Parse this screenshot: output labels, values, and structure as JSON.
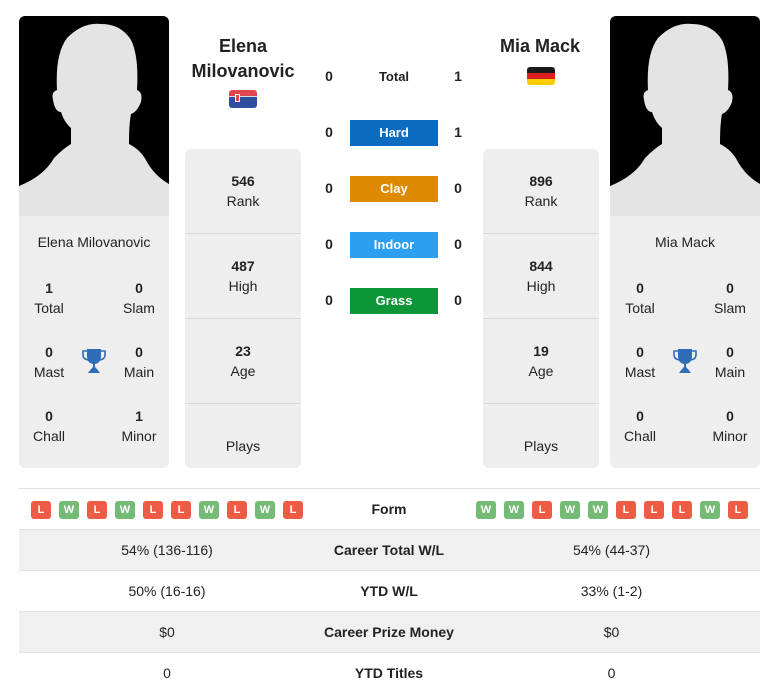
{
  "player1": {
    "name": "Elena Milovanovic",
    "name_line1": "Elena",
    "name_line2": "Milovanovic",
    "country": "Serbia",
    "flag_icon": "serbia-flag-icon",
    "titles": {
      "total": {
        "value": "1",
        "label": "Total"
      },
      "slam": {
        "value": "0",
        "label": "Slam"
      },
      "mast": {
        "value": "0",
        "label": "Mast"
      },
      "main": {
        "value": "0",
        "label": "Main"
      },
      "chall": {
        "value": "0",
        "label": "Chall"
      },
      "minor": {
        "value": "1",
        "label": "Minor"
      }
    },
    "stats": {
      "rank": {
        "value": "546",
        "label": "Rank"
      },
      "high": {
        "value": "487",
        "label": "High"
      },
      "age": {
        "value": "23",
        "label": "Age"
      },
      "plays": {
        "label": "Plays"
      }
    },
    "form": [
      "L",
      "W",
      "L",
      "W",
      "L",
      "L",
      "W",
      "L",
      "W",
      "L"
    ]
  },
  "player2": {
    "name": "Mia Mack",
    "country": "Germany",
    "flag_icon": "germany-flag-icon",
    "titles": {
      "total": {
        "value": "0",
        "label": "Total"
      },
      "slam": {
        "value": "0",
        "label": "Slam"
      },
      "mast": {
        "value": "0",
        "label": "Mast"
      },
      "main": {
        "value": "0",
        "label": "Main"
      },
      "chall": {
        "value": "0",
        "label": "Chall"
      },
      "minor": {
        "value": "0",
        "label": "Minor"
      }
    },
    "stats": {
      "rank": {
        "value": "896",
        "label": "Rank"
      },
      "high": {
        "value": "844",
        "label": "High"
      },
      "age": {
        "value": "19",
        "label": "Age"
      },
      "plays": {
        "label": "Plays"
      }
    },
    "form": [
      "W",
      "W",
      "L",
      "W",
      "W",
      "L",
      "L",
      "L",
      "W",
      "L"
    ]
  },
  "h2h": [
    {
      "label": "Total",
      "p1": "0",
      "p2": "1",
      "color": ""
    },
    {
      "label": "Hard",
      "p1": "0",
      "p2": "1",
      "color": "#0b6bbf"
    },
    {
      "label": "Clay",
      "p1": "0",
      "p2": "0",
      "color": "#dd8a00"
    },
    {
      "label": "Indoor",
      "p1": "0",
      "p2": "0",
      "color": "#2d9ff0"
    },
    {
      "label": "Grass",
      "p1": "0",
      "p2": "0",
      "color": "#0d9638"
    }
  ],
  "comparison": {
    "form_label": "Form",
    "rows": [
      {
        "label": "Career Total W/L",
        "p1": "54% (136-116)",
        "p2": "54% (44-37)"
      },
      {
        "label": "YTD W/L",
        "p1": "50% (16-16)",
        "p2": "33% (1-2)"
      },
      {
        "label": "Career Prize Money",
        "p1": "$0",
        "p2": "$0"
      },
      {
        "label": "YTD Titles",
        "p1": "0",
        "p2": "0"
      }
    ]
  },
  "colors": {
    "win": "#74bb75",
    "loss": "#ee5c45",
    "trophy": "#2f6db8",
    "card_bg": "#eeeeee"
  }
}
